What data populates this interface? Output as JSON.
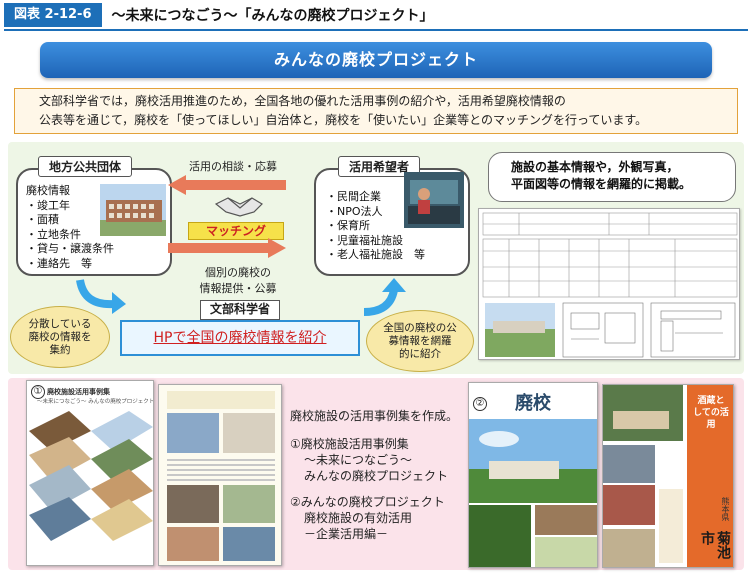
{
  "header": {
    "figure_label": "図表 2-12-6",
    "title": "〜未来につなごう〜「みんなの廃校プロジェクト」"
  },
  "banner": {
    "title": "みんなの廃校プロジェクト"
  },
  "intro": {
    "line1": "文部科学省では，廃校活用推進のため，全国各地の優れた活用事例の紹介や，活用希望廃校情報の",
    "line2": "公表等を通じて，廃校を「使ってほしい」自治体と，廃校を「使いたい」企業等とのマッチングを行っています。"
  },
  "local_gov": {
    "label": "地方公共団体",
    "items": [
      "廃校情報",
      "・竣工年",
      "・面積",
      "・立地条件",
      "・貸与・譲渡条件",
      "・連絡先　等"
    ]
  },
  "applicants": {
    "label": "活用希望者",
    "items": [
      "・民間企業",
      "・NPO法人",
      "・保育所",
      "・児童福祉施設",
      "・老人福祉施設　等"
    ]
  },
  "flow": {
    "consult_label": "活用の相談・応募",
    "matching_label": "マッチング",
    "provide_line1": "個別の廃校の",
    "provide_line2": "情報提供・公募"
  },
  "mext": {
    "label": "文部科学省",
    "hp_text": "HPで全国の廃校情報を紹介"
  },
  "bubbles": {
    "left": [
      "分散している",
      "廃校の情報を",
      "集約"
    ],
    "right": [
      "全国の廃校の公",
      "募情報を網羅",
      "的に紹介"
    ]
  },
  "sheet_callout": {
    "line1": "施設の基本情報や，外観写真，",
    "line2": "平面図等の情報を網羅的に掲載。"
  },
  "cases": {
    "intro": "廃校施設の活用事例集を作成。",
    "item1_title": "①廃校施設活用事例集",
    "item1_sub1": "〜未来につなごう〜",
    "item1_sub2": "みんなの廃校プロジェクト",
    "item2_title": "②みんなの廃校プロジェクト",
    "item2_sub1": "廃校施設の有効活用",
    "item2_sub2": "－企業活用編－"
  },
  "book1": {
    "number": "①",
    "title": "廃校施設活用事例集",
    "subtitle": "〜未来につなごう〜 みんなの廃校プロジェクト"
  },
  "book2": {
    "number": "②",
    "kanji": "廃校",
    "right_title": "酒蔵としての活用",
    "city": "菊池市",
    "pref": "熊本県"
  },
  "colors": {
    "accent_blue": "#1d6fb8",
    "matching_yellow": "#f6e14a",
    "hp_red": "#d02020",
    "green_area": "#eef6e6",
    "pink_area": "#fbe3ea"
  }
}
